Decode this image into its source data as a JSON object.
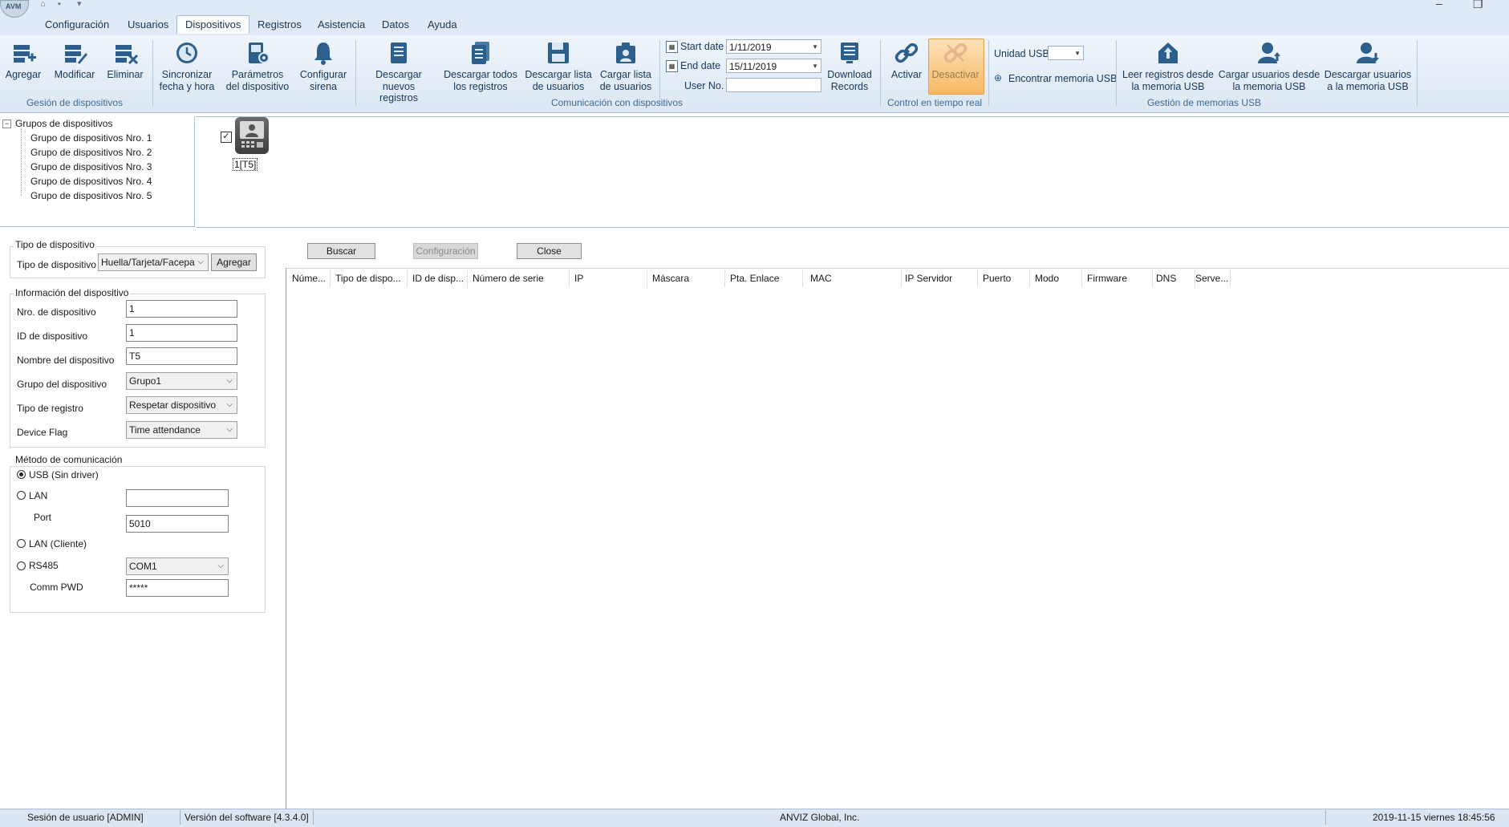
{
  "menu": {
    "items": [
      "Configuración",
      "Usuarios",
      "Dispositivos",
      "Registros",
      "Asistencia",
      "Datos",
      "Ayuda"
    ],
    "active": "Dispositivos"
  },
  "ribbon": {
    "gestion": {
      "agregar": "Agregar",
      "modificar": "Modificar",
      "eliminar": "Eliminar",
      "group": "Gesión de dispositivos"
    },
    "comm": {
      "sincronizar_1": "Sincronizar",
      "sincronizar_2": "fecha y hora",
      "parametros_1": "Parámetros",
      "parametros_2": "del dispositivo",
      "sirena_1": "Configurar",
      "sirena_2": "sirena",
      "desc_nuevos_1": "Descargar",
      "desc_nuevos_2": "nuevos registros",
      "desc_todos_1": "Descargar todos",
      "desc_todos_2": "los registros",
      "desc_lista_1": "Descargar lista",
      "desc_lista_2": "de usuarios",
      "cargar_lista_1": "Cargar lista",
      "cargar_lista_2": "de usuarios",
      "start_label": "Start date",
      "start_value": "1/11/2019",
      "end_label": "End date",
      "end_value": "15/11/2019",
      "user_label": "User No.",
      "user_value": "",
      "download_1": "Download",
      "download_2": "Records",
      "group": "Comunicación con dispositivos"
    },
    "realtime": {
      "activar": "Activar",
      "desactivar": "Desactivar",
      "group": "Control en tiempo real"
    },
    "usb": {
      "unidad_label": "Unidad USB",
      "unidad_value": "",
      "encontrar": "Encontrar memoria USB",
      "leer_1": "Leer registros desde",
      "leer_2": "la memoria USB",
      "cargar_1": "Cargar usuarios desde",
      "cargar_2": "la memoria USB",
      "descargar_1": "Descargar usuarios",
      "descargar_2": "a la memoria USB",
      "group": "Gestión de memorias USB"
    }
  },
  "tree": {
    "root": "Grupos de dispositivos",
    "children": [
      "Grupo de dispositivos Nro. 1",
      "Grupo de dispositivos Nro. 2",
      "Grupo de dispositivos Nro. 3",
      "Grupo de dispositivos Nro. 4",
      "Grupo de dispositivos Nro. 5"
    ]
  },
  "device_tile": {
    "label": "1[T5]",
    "checked": true
  },
  "form": {
    "tipo_legend": "Tipo de dispositivo",
    "tipo_label": "Tipo de dispositivo",
    "tipo_value": "Huella/Tarjeta/Facepa",
    "tipo_btn": "Agregar",
    "info_legend": "Información del dispositivo",
    "nro_label": "Nro. de dispositivo",
    "nro_value": "1",
    "id_label": "ID de dispositivo",
    "id_value": "1",
    "nombre_label": "Nombre del dispositivo",
    "nombre_value": "T5",
    "grupo_label": "Grupo del dispositivo",
    "grupo_value": "Grupo1",
    "registro_label": "Tipo de registro",
    "registro_value": "Respetar dispositivo",
    "flag_label": "Device Flag",
    "flag_value": "Time attendance",
    "metodo_legend": "Método de comunicación",
    "usb_label": "USB (Sin driver)",
    "lan_label": "LAN",
    "lan_value": "",
    "port_label": "Port",
    "port_value": "5010",
    "lanc_label": "LAN (Cliente)",
    "rs485_label": "RS485",
    "rs485_value": "COM1",
    "pwd_label": "Comm PWD",
    "pwd_value": "*****",
    "selected_method": "USB (Sin driver)"
  },
  "actions": {
    "buscar": "Buscar",
    "configuracion": "Configuración",
    "close": "Close"
  },
  "grid": {
    "columns": [
      "Núme...",
      "Tipo de dispo...",
      "ID de disp...",
      "Número de serie",
      "IP",
      "Máscara",
      "Pta. Enlace",
      "MAC",
      "IP Servidor",
      "Puerto",
      "Modo",
      "Firmware",
      "DNS",
      "Serve..."
    ]
  },
  "status": {
    "session": "Sesión de usuario  [ADMIN]",
    "version": "Versión del software  [4.3.4.0]",
    "company": "ANVIZ Global, Inc.",
    "datetime": "2019-11-15 viernes 18:45:56"
  },
  "colors": {
    "accent": "#3c6a95",
    "active_button": "#f7b864",
    "ribbon_bg": "#dce7f3"
  }
}
